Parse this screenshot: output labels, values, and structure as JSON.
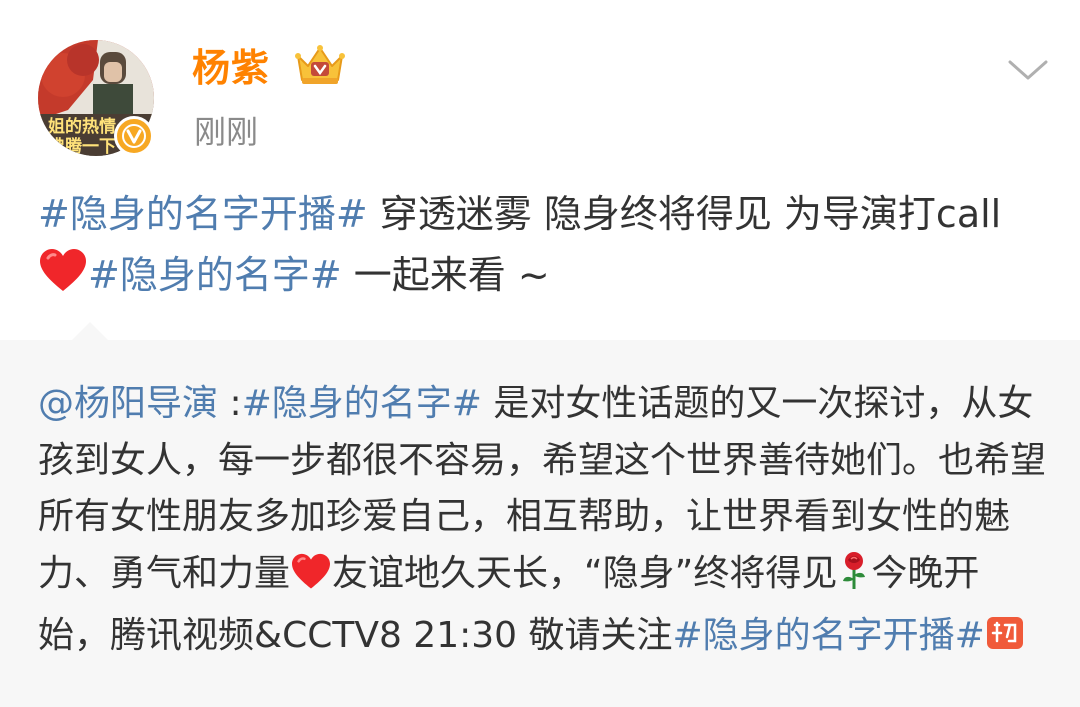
{
  "header": {
    "username": "杨紫",
    "timestamp": "刚刚",
    "avatar_caption_line1": "姐的热情",
    "avatar_caption_line2": "沸腾一下",
    "vip_icon": "crown-vip-icon",
    "verified_icon": "verified-v-icon",
    "more_icon": "chevron-down-icon"
  },
  "post": {
    "hashtag1": "#隐身的名字开播#",
    "text1": " 穿透迷雾 隐身终将得见 为导演打call",
    "heart_icon": "red-heart-icon",
    "hashtag2": "#隐身的名字#",
    "text2": " 一起来看 ~"
  },
  "repost": {
    "mention": "@杨阳导演",
    "colon": " :",
    "hashtag1": "#隐身的名字#",
    "text1": " 是对女性话题的又一次探讨，从女孩到女人，每一步都很不容易，希望这个世界善待她们。也希望所有女性朋友多加珍爱自己，相互帮助，让世界看到女性的魅力、勇气和力量",
    "heart_icon": "red-heart-icon",
    "text2": "友谊地久天长，“隐身”终将得见",
    "rose_icon": "rose-icon",
    "text3": "今晚开始，腾讯视频&CCTV8 21:30 敬请关注",
    "hashtag2": "#隐身的名字开播#",
    "cheer_icon": "cheer-jiayou-icon"
  },
  "colors": {
    "username": "#ff8200",
    "link": "#507daf",
    "text": "#333333",
    "timestamp": "#8a8a8a",
    "repost_bg": "#f7f7f7"
  }
}
